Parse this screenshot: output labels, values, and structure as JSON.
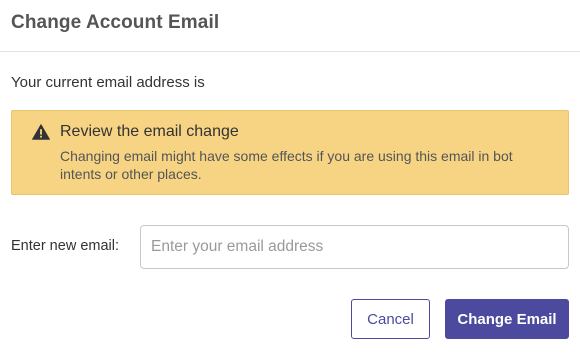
{
  "dialog": {
    "title": "Change Account Email",
    "current_email_label": "Your current email address is"
  },
  "alert": {
    "icon": "warning-icon",
    "title": "Review the email change",
    "body": "Changing email might have some effects if you are using this email in bot intents or other places.",
    "background_color": "#f6d484"
  },
  "form": {
    "new_email_label": "Enter new email:",
    "new_email_value": "",
    "new_email_placeholder": "Enter your email address"
  },
  "actions": {
    "cancel_label": "Cancel",
    "change_label": "Change Email",
    "accent_color": "#4b4a9e"
  }
}
